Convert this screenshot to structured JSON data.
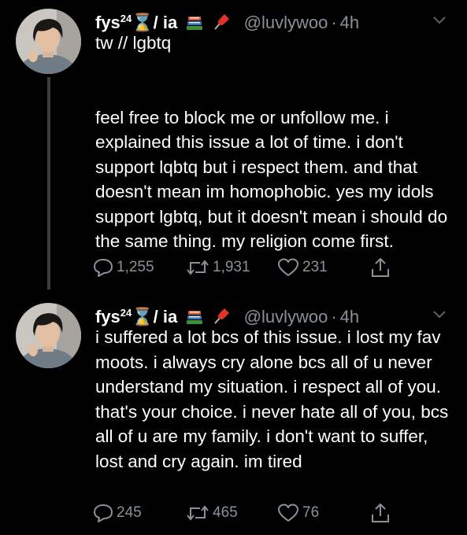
{
  "tweets": [
    {
      "display_name": "fys",
      "name_superscript": "24",
      "name_suffix": "⌛/ ia",
      "emoji_1": "books-emoji",
      "emoji_2": "pushpin-emoji",
      "handle": "@luvlywoo",
      "separator": "·",
      "time": "4h",
      "text": "tw // lgbtq\n\n\nfeel free to block me or unfollow me. i explained this issue a lot of time. i don't support lqbtq but i respect them. and that doesn't mean im homophobic. yes my idols support lgbtq, but it doesn't mean i should do the same thing. my religion come first.",
      "replies": "1,255",
      "retweets": "1,931",
      "likes": "231"
    },
    {
      "display_name": "fys",
      "name_superscript": "24",
      "name_suffix": "⌛/ ia",
      "emoji_1": "books-emoji",
      "emoji_2": "pushpin-emoji",
      "handle": "@luvlywoo",
      "separator": "·",
      "time": "4h",
      "text": "i suffered a lot bcs of this issue. i lost my fav moots. i always cry alone bcs all of u never understand my situation. i respect all of you. that's your choice. i never hate all of you, bcs all of u are my family. i don't want to suffer, lost and cry again. im tired",
      "replies": "245",
      "retweets": "465",
      "likes": "76"
    }
  ],
  "colors": {
    "background": "#000000",
    "text": "#ffffff",
    "secondary": "#8a9199",
    "thread_line": "#3a3d40"
  },
  "icons": {
    "reply": "speech-bubble-icon",
    "retweet": "retweet-arrows-icon",
    "like": "heart-icon",
    "share": "share-upload-icon",
    "more": "chevron-down-icon"
  }
}
